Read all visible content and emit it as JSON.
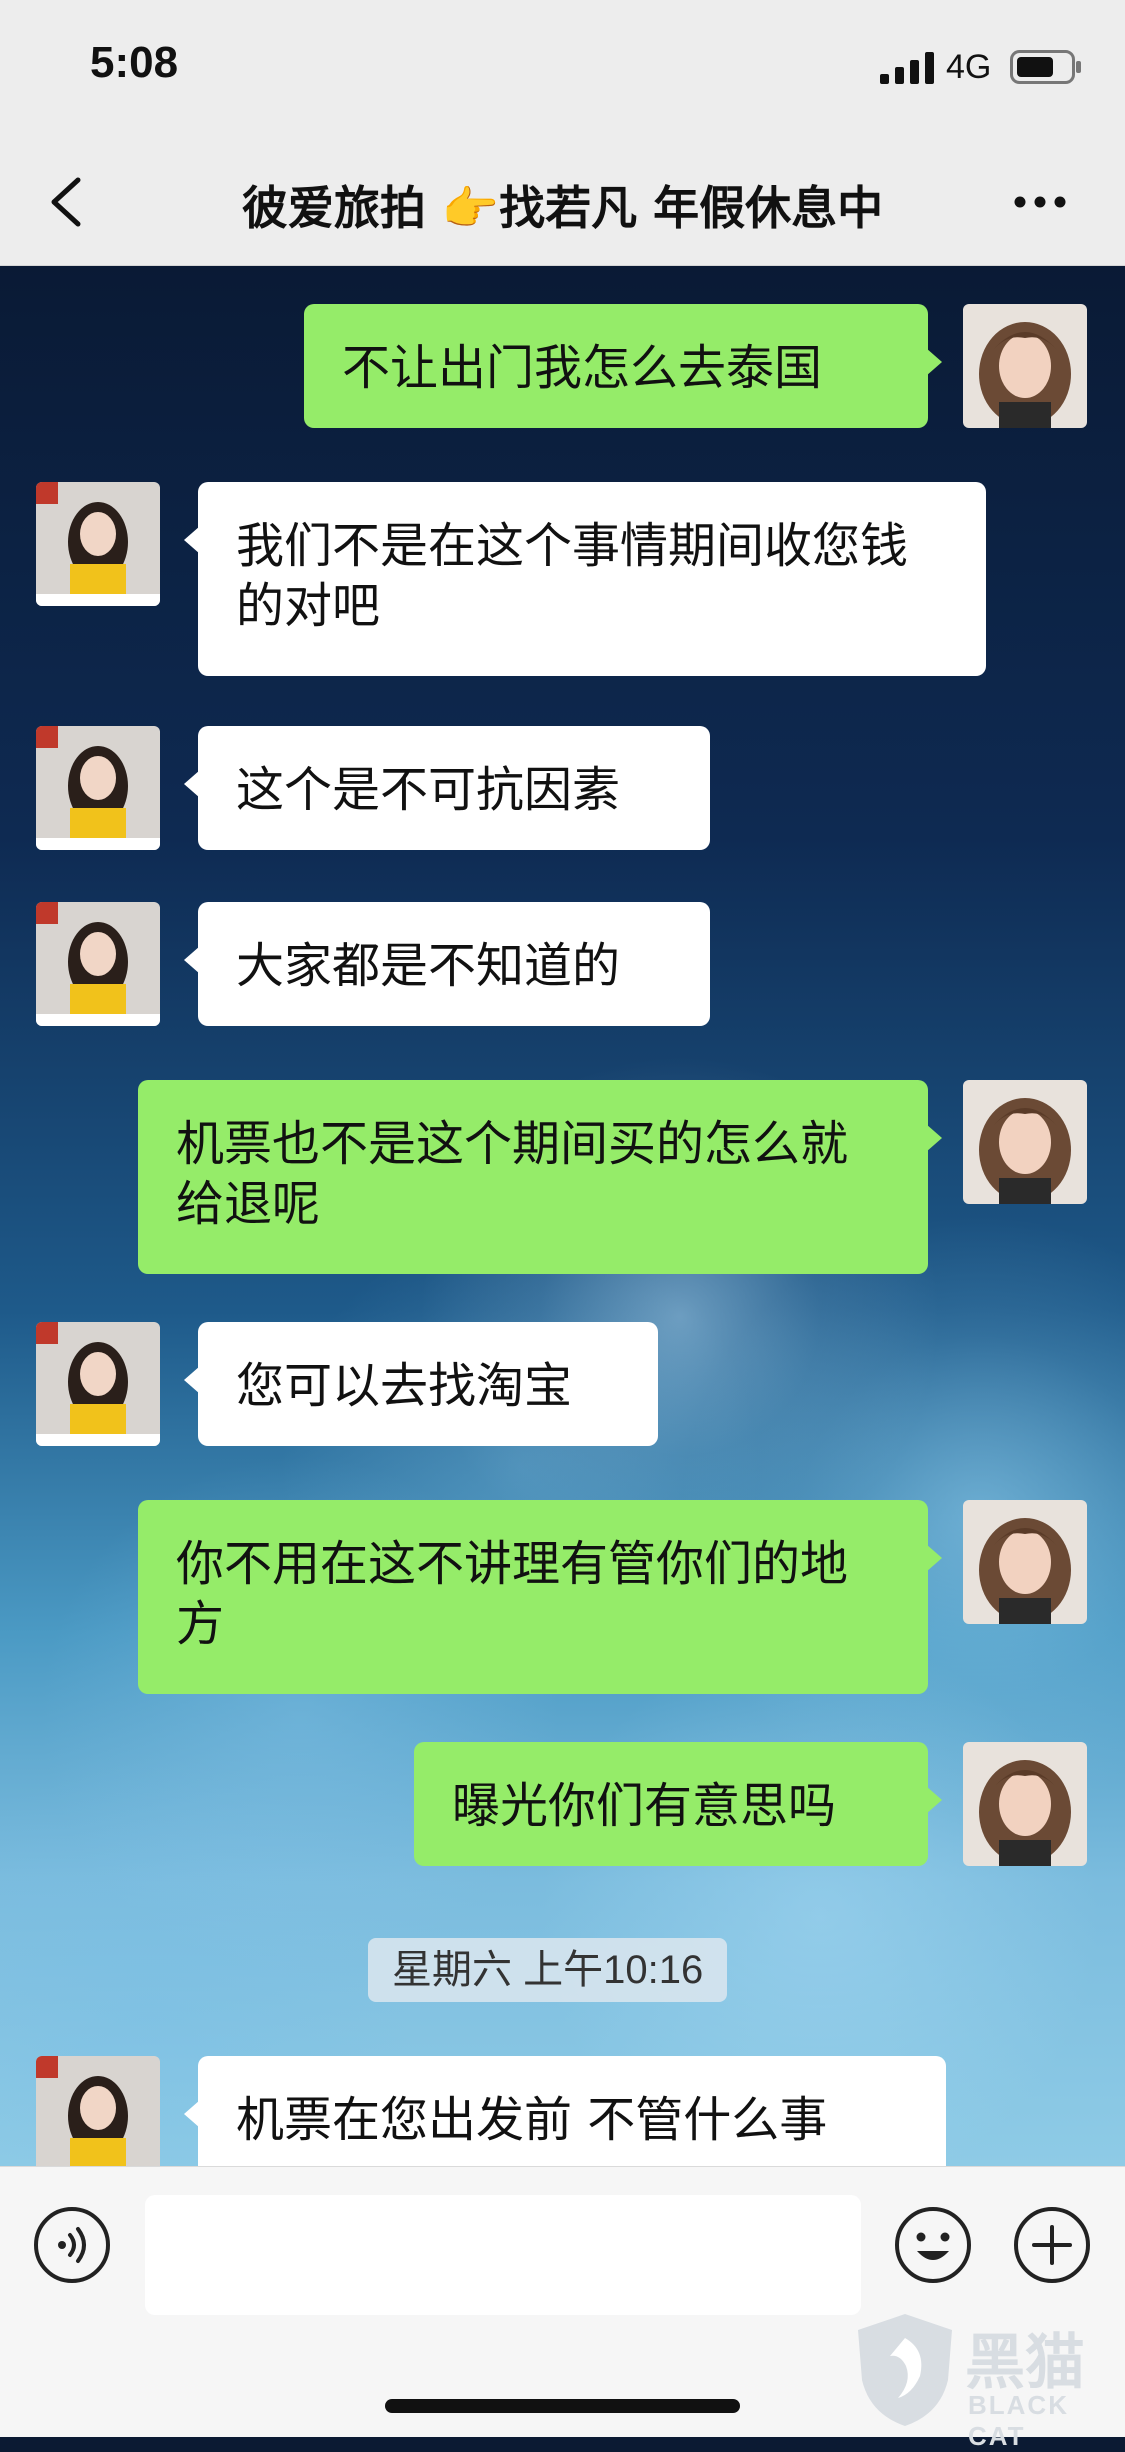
{
  "status_bar": {
    "time": "5:08",
    "network": "4G"
  },
  "nav": {
    "title": "彼爱旅拍 👉找若凡 年假休息中"
  },
  "messages": [
    {
      "side": "out",
      "text": "不让出门我怎么去泰国"
    },
    {
      "side": "in",
      "text": "我们不是在这个事情期间收您钱的对吧"
    },
    {
      "side": "in",
      "text": "这个是不可抗因素"
    },
    {
      "side": "in",
      "text": "大家都是不知道的"
    },
    {
      "side": "out",
      "text": "机票也不是这个期间买的怎么就给退呢"
    },
    {
      "side": "in",
      "text": "您可以去找淘宝"
    },
    {
      "side": "out",
      "text": "你不用在这不讲理有管你们的地方"
    },
    {
      "side": "out",
      "text": "曝光你们有意思吗"
    },
    {
      "side": "in",
      "text": "机票在您出发前 不管什么事"
    }
  ],
  "timestamp": "星期六 上午10:16",
  "input": {
    "value": "",
    "placeholder": ""
  },
  "watermark": {
    "main": "黑猫",
    "sub": "BLACK CAT"
  },
  "colors": {
    "bubble_out": "#95ec69",
    "bubble_in": "#ffffff",
    "bar_bg": "#ededed"
  },
  "icons": [
    "back-icon",
    "more-icon",
    "voice-icon",
    "emoji-icon",
    "plus-icon",
    "signal-icon",
    "battery-icon"
  ]
}
